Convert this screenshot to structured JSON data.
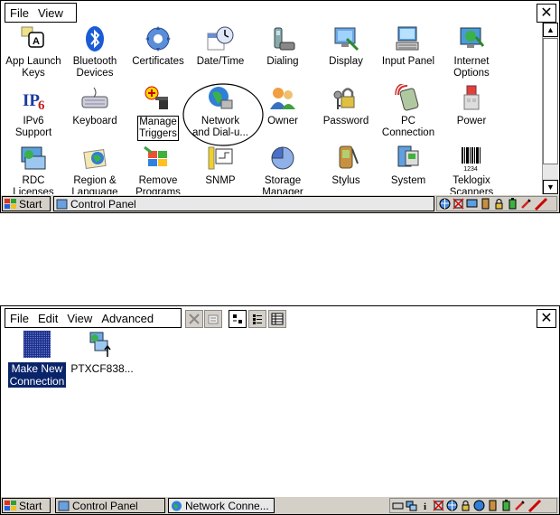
{
  "control_panel": {
    "menus": [
      "File",
      "View"
    ],
    "close": "✕",
    "items": [
      {
        "label": "App Launch\nKeys",
        "icon": "app-launch-keys-icon"
      },
      {
        "label": "Bluetooth\nDevices",
        "icon": "bluetooth-icon"
      },
      {
        "label": "Certificates",
        "icon": "certificates-icon"
      },
      {
        "label": "Date/Time",
        "icon": "date-time-icon"
      },
      {
        "label": "Dialing",
        "icon": "dialing-icon"
      },
      {
        "label": "Display",
        "icon": "display-icon"
      },
      {
        "label": "Input Panel",
        "icon": "input-panel-icon"
      },
      {
        "label": "Internet\nOptions",
        "icon": "internet-options-icon"
      },
      {
        "label": "IPv6\nSupport",
        "icon": "ipv6-icon"
      },
      {
        "label": "Keyboard",
        "icon": "keyboard-icon"
      },
      {
        "label": "Manage\nTriggers",
        "icon": "manage-triggers-icon"
      },
      {
        "label": "Network\nand Dial-u...",
        "icon": "network-dialup-icon"
      },
      {
        "label": "Owner",
        "icon": "owner-icon"
      },
      {
        "label": "Password",
        "icon": "password-icon"
      },
      {
        "label": "PC\nConnection",
        "icon": "pc-connection-icon"
      },
      {
        "label": "Power",
        "icon": "power-icon"
      },
      {
        "label": "RDC\nLicenses",
        "icon": "rdc-licenses-icon"
      },
      {
        "label": "Region &\nLanguage",
        "icon": "region-language-icon"
      },
      {
        "label": "Remove\nPrograms",
        "icon": "remove-programs-icon"
      },
      {
        "label": "SNMP",
        "icon": "snmp-icon"
      },
      {
        "label": "Storage\nManager",
        "icon": "storage-manager-icon"
      },
      {
        "label": "Stylus",
        "icon": "stylus-icon"
      },
      {
        "label": "System",
        "icon": "system-icon"
      },
      {
        "label": "Teklogix\nScanners",
        "icon": "teklogix-scanners-icon"
      }
    ],
    "taskbar": {
      "start": "Start",
      "window": "Control Panel"
    }
  },
  "network_connections": {
    "menus": [
      "File",
      "Edit",
      "View",
      "Advanced"
    ],
    "close": "✕",
    "items": [
      {
        "label": "Make New\nConnection",
        "icon": "make-new-connection-icon"
      },
      {
        "label": "PTXCF838...",
        "icon": "network-connection-icon"
      }
    ],
    "taskbar": {
      "start": "Start",
      "window1": "Control Panel",
      "window2": "Network Conne..."
    }
  }
}
